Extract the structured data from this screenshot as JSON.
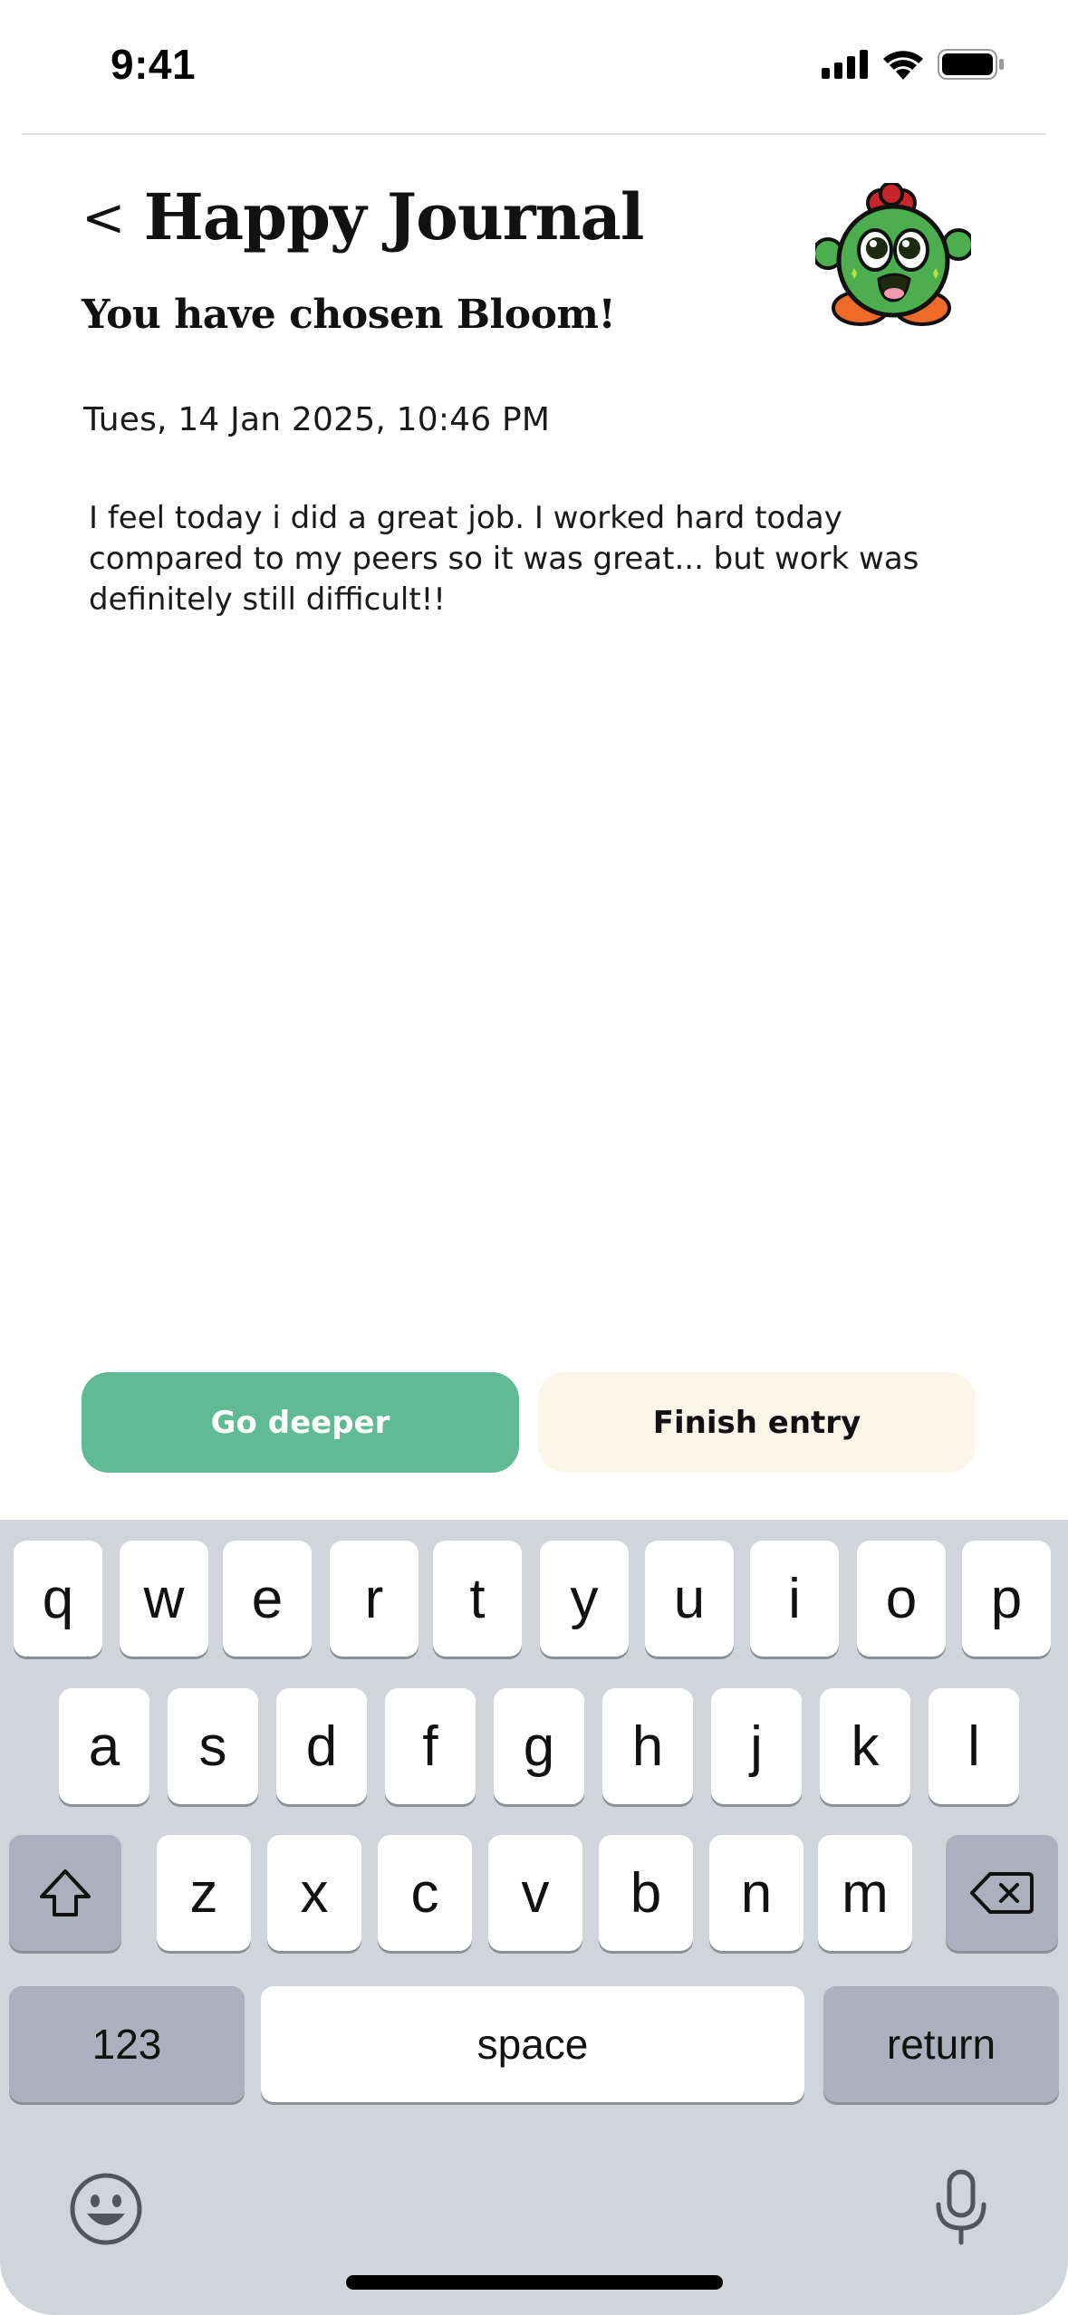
{
  "status": {
    "time": "9:41",
    "icons": [
      "signal-icon",
      "wifi-icon",
      "battery-icon"
    ]
  },
  "header": {
    "back": "<",
    "title": "Happy Journal",
    "subtitle": "You have chosen Bloom!"
  },
  "mascot": {
    "name": "bloom-mascot-icon"
  },
  "entry": {
    "date": "Tues, 14 Jan 2025, 10:46 PM",
    "text": "I feel today i did a great job. I worked hard today compared to my peers so it was great... but work was definitely still difficult!!"
  },
  "actions": {
    "go_deeper": "Go deeper",
    "finish": "Finish entry"
  },
  "colors": {
    "accent": "#5fba95",
    "finish_bg": "#fbf6ea",
    "keyboard_bg": "#d1d4db"
  },
  "keyboard": {
    "row1": [
      "q",
      "w",
      "e",
      "r",
      "t",
      "y",
      "u",
      "i",
      "o",
      "p"
    ],
    "row2": [
      "a",
      "s",
      "d",
      "f",
      "g",
      "h",
      "j",
      "k",
      "l"
    ],
    "row3": [
      "z",
      "x",
      "c",
      "v",
      "b",
      "n",
      "m"
    ],
    "numbers": "123",
    "space": "space",
    "return": "return"
  }
}
